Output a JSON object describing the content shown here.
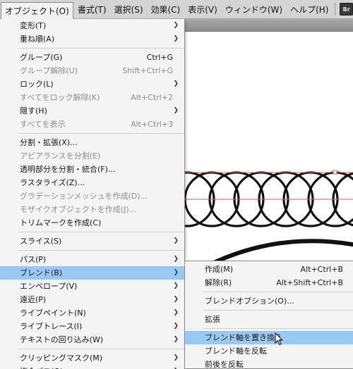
{
  "menubar": {
    "items": [
      "オブジェクト(O)",
      "書式(T)",
      "選択(S)",
      "効果(C)",
      "表示(V)",
      "ウィンドウ(W)",
      "ヘルプ(H)"
    ],
    "bridge_badge": "Br"
  },
  "object_menu": {
    "items": [
      {
        "label": "変形(T)",
        "shortcut": "",
        "submenu": true,
        "disabled": false
      },
      {
        "label": "重ね順(A)",
        "shortcut": "",
        "submenu": true,
        "disabled": false
      },
      {
        "separator": true
      },
      {
        "label": "グループ(G)",
        "shortcut": "Ctrl+G",
        "submenu": false,
        "disabled": false
      },
      {
        "label": "グループ解除(U)",
        "shortcut": "Shift+Ctrl+G",
        "submenu": false,
        "disabled": true
      },
      {
        "label": "ロック(L)",
        "shortcut": "",
        "submenu": true,
        "disabled": false
      },
      {
        "label": "すべてをロック解除(K)",
        "shortcut": "Alt+Ctrl+2",
        "submenu": false,
        "disabled": true
      },
      {
        "label": "隠す(H)",
        "shortcut": "",
        "submenu": true,
        "disabled": false
      },
      {
        "label": "すべてを表示",
        "shortcut": "Alt+Ctrl+3",
        "submenu": false,
        "disabled": true
      },
      {
        "separator": true
      },
      {
        "label": "分割・拡張(X)...",
        "shortcut": "",
        "submenu": false,
        "disabled": false
      },
      {
        "label": "アピアランスを分割(E)",
        "shortcut": "",
        "submenu": false,
        "disabled": true
      },
      {
        "label": "透明部分を分割・統合(F)...",
        "shortcut": "",
        "submenu": false,
        "disabled": false
      },
      {
        "label": "ラスタライズ(Z)...",
        "shortcut": "",
        "submenu": false,
        "disabled": false
      },
      {
        "label": "グラデーションメッシュを作成(D)...",
        "shortcut": "",
        "submenu": false,
        "disabled": true
      },
      {
        "label": "モザイクオブジェクトを作成(J)...",
        "shortcut": "",
        "submenu": false,
        "disabled": true
      },
      {
        "label": "トリムマークを作成(C)",
        "shortcut": "",
        "submenu": false,
        "disabled": false
      },
      {
        "separator": true
      },
      {
        "label": "スライス(S)",
        "shortcut": "",
        "submenu": true,
        "disabled": false
      },
      {
        "separator": true
      },
      {
        "label": "パス(P)",
        "shortcut": "",
        "submenu": true,
        "disabled": false
      },
      {
        "label": "ブレンド(B)",
        "shortcut": "",
        "submenu": true,
        "disabled": false,
        "highlighted": true
      },
      {
        "label": "エンベロープ(V)",
        "shortcut": "",
        "submenu": true,
        "disabled": false
      },
      {
        "label": "遠近(P)",
        "shortcut": "",
        "submenu": true,
        "disabled": false
      },
      {
        "label": "ライブペイント(N)",
        "shortcut": "",
        "submenu": true,
        "disabled": false
      },
      {
        "label": "ライブトレース(I)",
        "shortcut": "",
        "submenu": true,
        "disabled": false
      },
      {
        "label": "テキストの回り込み(W)",
        "shortcut": "",
        "submenu": true,
        "disabled": false
      },
      {
        "separator": true
      },
      {
        "label": "クリッピングマスク(M)",
        "shortcut": "",
        "submenu": true,
        "disabled": false
      },
      {
        "label": "複合パス(O)",
        "shortcut": "",
        "submenu": true,
        "disabled": false
      }
    ]
  },
  "blend_submenu": {
    "items": [
      {
        "label": "作成(M)",
        "shortcut": "Alt+Ctrl+B"
      },
      {
        "label": "解除(R)",
        "shortcut": "Alt+Shift+Ctrl+B"
      },
      {
        "separator": true
      },
      {
        "label": "ブレンドオプション(O)...",
        "shortcut": ""
      },
      {
        "separator": true
      },
      {
        "label": "拡張",
        "shortcut": ""
      },
      {
        "separator": true
      },
      {
        "label": "ブレンド軸を置き換え",
        "shortcut": "",
        "highlighted": true
      },
      {
        "label": "ブレンド軸を反転",
        "shortcut": ""
      },
      {
        "label": "前後を反転",
        "shortcut": ""
      }
    ]
  },
  "colors": {
    "highlight": "#99c9f3",
    "guide_line": "#d05a66",
    "stroke": "#111111"
  }
}
